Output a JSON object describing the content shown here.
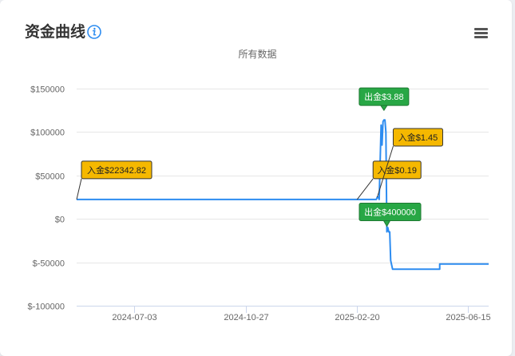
{
  "card": {
    "title": "资金曲线",
    "menu_icon": "hamburger-menu-icon",
    "info_icon": "info-circle-icon"
  },
  "colors": {
    "line": "#2d8cf0",
    "grid": "#e6e6e6",
    "axis": "#ccd6eb",
    "deposit_flag": "#f5b800",
    "withdraw_flag": "#28a745",
    "info_icon": "#2d8cf0"
  },
  "chart_data": {
    "type": "line",
    "subtitle": "所有数据",
    "ylim": [
      -100000,
      150000
    ],
    "y_ticks": [
      150000,
      100000,
      50000,
      0,
      -50000,
      -100000
    ],
    "y_tick_labels": [
      "$150000",
      "$100000",
      "$50000",
      "$0",
      "$-50000",
      "$-100000"
    ],
    "xlim": [
      "2024-05-04",
      "2025-07-07"
    ],
    "x_ticks": [
      "2024-07-03",
      "2024-10-27",
      "2025-02-20",
      "2025-06-15"
    ],
    "grid": true,
    "legend": "none",
    "series": [
      {
        "points": [
          [
            "2024-05-04",
            22342.82
          ],
          [
            "2025-03-12",
            22343
          ],
          [
            "2025-03-13",
            25000
          ],
          [
            "2025-03-14",
            25000
          ],
          [
            "2025-03-15",
            22350
          ],
          [
            "2025-03-17",
            108000
          ],
          [
            "2025-03-18",
            85000
          ],
          [
            "2025-03-19",
            112000
          ],
          [
            "2025-03-20",
            114000
          ],
          [
            "2025-03-21",
            114000
          ],
          [
            "2025-03-22",
            100000
          ],
          [
            "2025-03-23",
            -15000
          ],
          [
            "2025-03-24",
            -10000
          ],
          [
            "2025-03-25",
            -15000
          ],
          [
            "2025-03-26",
            -15000
          ],
          [
            "2025-03-27",
            -48000
          ],
          [
            "2025-03-28",
            -53000
          ],
          [
            "2025-03-29",
            -58000
          ],
          [
            "2025-05-14",
            -58000
          ],
          [
            "2025-05-17",
            -52000
          ],
          [
            "2025-07-07",
            -52000
          ]
        ]
      }
    ],
    "annotations": [
      {
        "kind": "deposit",
        "label": "入金$22342.82",
        "date": "2024-05-04",
        "value": 22342.82
      },
      {
        "kind": "deposit",
        "label": "入金$0.19",
        "date": "2025-02-20",
        "value": 22343
      },
      {
        "kind": "deposit",
        "label": "入金$1.45",
        "date": "2025-03-13",
        "value": 25000
      },
      {
        "kind": "withdraw",
        "label": "出金$3.88",
        "date": "2025-03-20",
        "value": 114000
      },
      {
        "kind": "withdraw",
        "label": "出金$400000",
        "date": "2025-03-23",
        "value": -15000
      }
    ]
  }
}
